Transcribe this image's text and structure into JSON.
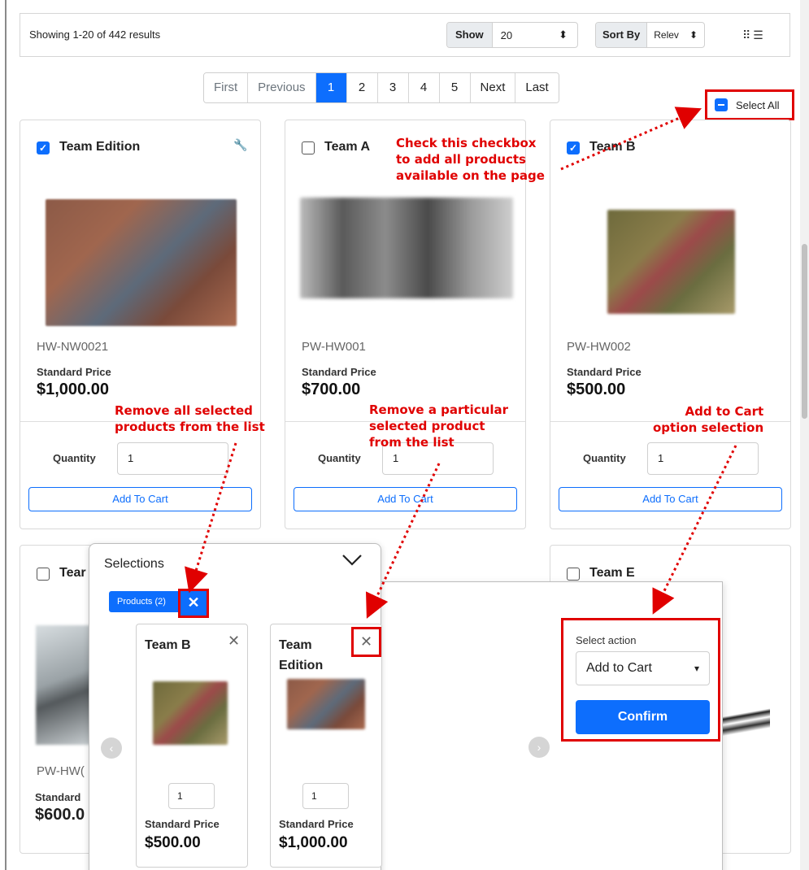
{
  "toolbar": {
    "results_text": "Showing 1-20 of 442 results",
    "show_label": "Show",
    "show_value": "20",
    "sort_label": "Sort By",
    "sort_value": "Relev"
  },
  "pagination": {
    "first": "First",
    "previous": "Previous",
    "pages": [
      "1",
      "2",
      "3",
      "4",
      "5"
    ],
    "current_page": "1",
    "next": "Next",
    "last": "Last"
  },
  "select_all": {
    "label": "Select All"
  },
  "products": [
    {
      "name": "Team Edition",
      "checked": true,
      "sku": "HW-NW0021",
      "price_label": "Standard Price",
      "price": "$1,000.00",
      "quantity_label": "Quantity",
      "quantity": "1",
      "add_to_cart": "Add To Cart"
    },
    {
      "name": "Team A",
      "checked": false,
      "sku": "PW-HW001",
      "price_label": "Standard Price",
      "price": "$700.00",
      "quantity_label": "Quantity",
      "quantity": "1",
      "add_to_cart": "Add To Cart"
    },
    {
      "name": "Team B",
      "checked": true,
      "sku": "PW-HW002",
      "price_label": "Standard Price",
      "price": "$500.00",
      "quantity_label": "Quantity",
      "quantity": "1",
      "add_to_cart": "Add To Cart"
    }
  ],
  "products_row2": [
    {
      "name": "Tear",
      "sku": "PW-HW(",
      "price_label": "Standard",
      "price": "$600.0"
    },
    {
      "name": "Team E"
    }
  ],
  "selections": {
    "title": "Selections",
    "chip_label": "Products (2)",
    "items": [
      {
        "name": "Team B",
        "quantity": "1",
        "price_label": "Standard Price",
        "price": "$500.00"
      },
      {
        "name": "Team Edition",
        "quantity": "1",
        "price_label": "Standard Price",
        "price": "$1,000.00"
      }
    ],
    "action_label": "Select action",
    "action_value": "Add to Cart",
    "confirm": "Confirm"
  },
  "annotations": {
    "select_all_note": [
      "Check this checkbox",
      "to add all products",
      "available on the page"
    ],
    "remove_all_note": [
      "Remove all selected",
      "products from the list"
    ],
    "remove_one_note": [
      "Remove a particular",
      "selected product",
      "from the list"
    ],
    "add_to_cart_note": [
      "Add to Cart",
      "option selection"
    ]
  },
  "colors": {
    "accent": "#0d6efd",
    "annotation_red": "#e00000"
  }
}
